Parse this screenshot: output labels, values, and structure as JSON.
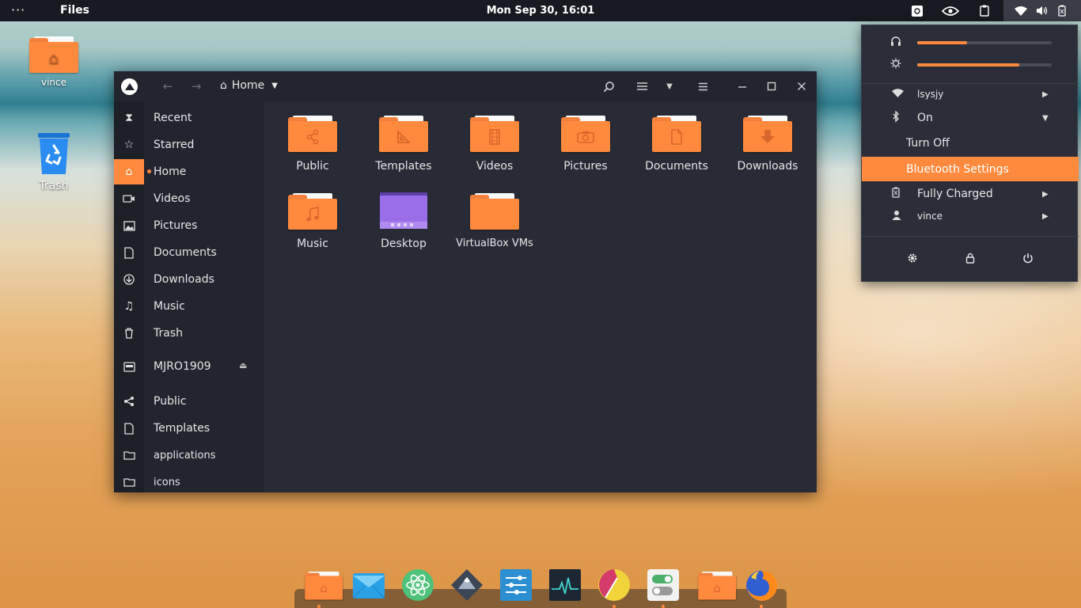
{
  "top_panel": {
    "menu_dots": "···",
    "app_name": "Files",
    "clock": "Mon Sep 30, 16:01"
  },
  "desktop": {
    "icons": [
      {
        "label": "vince"
      },
      {
        "label": "Trash"
      }
    ]
  },
  "file_manager": {
    "path_label": "Home",
    "sidebar": {
      "items": [
        {
          "label": "Recent",
          "icon": "clock-icon"
        },
        {
          "label": "Starred",
          "icon": "star-icon"
        },
        {
          "label": "Home",
          "icon": "home-icon"
        },
        {
          "label": "Videos",
          "icon": "video-icon"
        },
        {
          "label": "Pictures",
          "icon": "image-icon"
        },
        {
          "label": "Documents",
          "icon": "document-icon"
        },
        {
          "label": "Downloads",
          "icon": "download-icon"
        },
        {
          "label": "Music",
          "icon": "music-icon"
        },
        {
          "label": "Trash",
          "icon": "trash-icon"
        },
        {
          "label": "MJRO1909",
          "icon": "drive-icon"
        },
        {
          "label": "Public",
          "icon": "share-icon"
        },
        {
          "label": "Templates",
          "icon": "template-icon"
        },
        {
          "label": "applications",
          "icon": "folder-icon"
        },
        {
          "label": "icons",
          "icon": "folder-icon"
        }
      ]
    },
    "files": [
      {
        "label": "Public"
      },
      {
        "label": "Templates"
      },
      {
        "label": "Videos"
      },
      {
        "label": "Pictures"
      },
      {
        "label": "Documents"
      },
      {
        "label": "Downloads"
      },
      {
        "label": "Music"
      },
      {
        "label": "Desktop"
      },
      {
        "label": "VirtualBox VMs"
      }
    ]
  },
  "system_menu": {
    "volume_level": 0.37,
    "brightness_level": 0.76,
    "wifi_label": "lsysjy",
    "bluetooth_label": "On",
    "bluetooth_off": "Turn Off",
    "bluetooth_settings": "Bluetooth Settings",
    "battery_label": "Fully Charged",
    "user_label": "vince"
  },
  "colors": {
    "accent": "#ff8a3d",
    "panel": "#181a21",
    "window": "#282a35"
  }
}
